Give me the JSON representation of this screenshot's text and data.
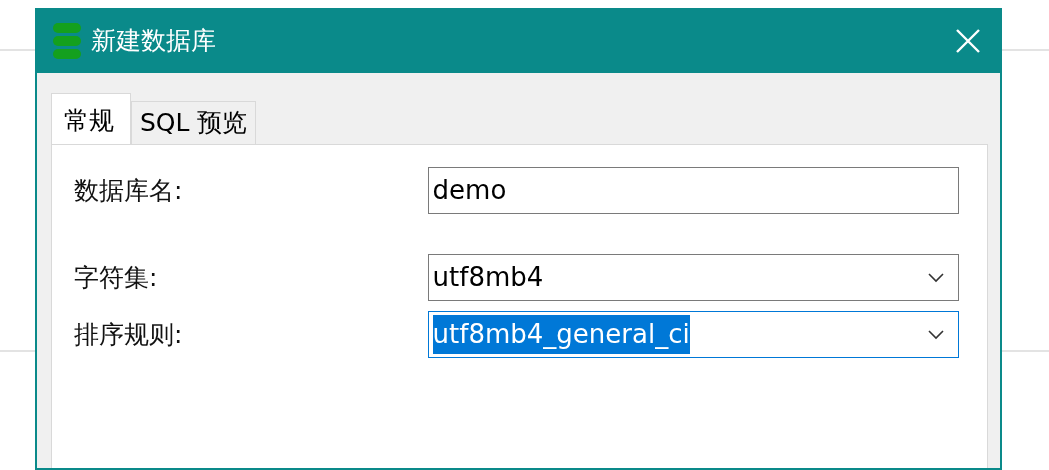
{
  "window": {
    "title": "新建数据库"
  },
  "tabs": [
    {
      "label": "常规",
      "selected": true
    },
    {
      "label": "SQL 预览",
      "selected": false
    }
  ],
  "fields": [
    {
      "kind": "text",
      "label": "数据库名:",
      "value": "demo",
      "focused": false
    },
    {
      "kind": "select",
      "label": "字符集:",
      "value": "utf8mb4",
      "focused": false
    },
    {
      "kind": "select",
      "label": "排序规则:",
      "value": "utf8mb4_general_ci",
      "focused": true
    }
  ]
}
